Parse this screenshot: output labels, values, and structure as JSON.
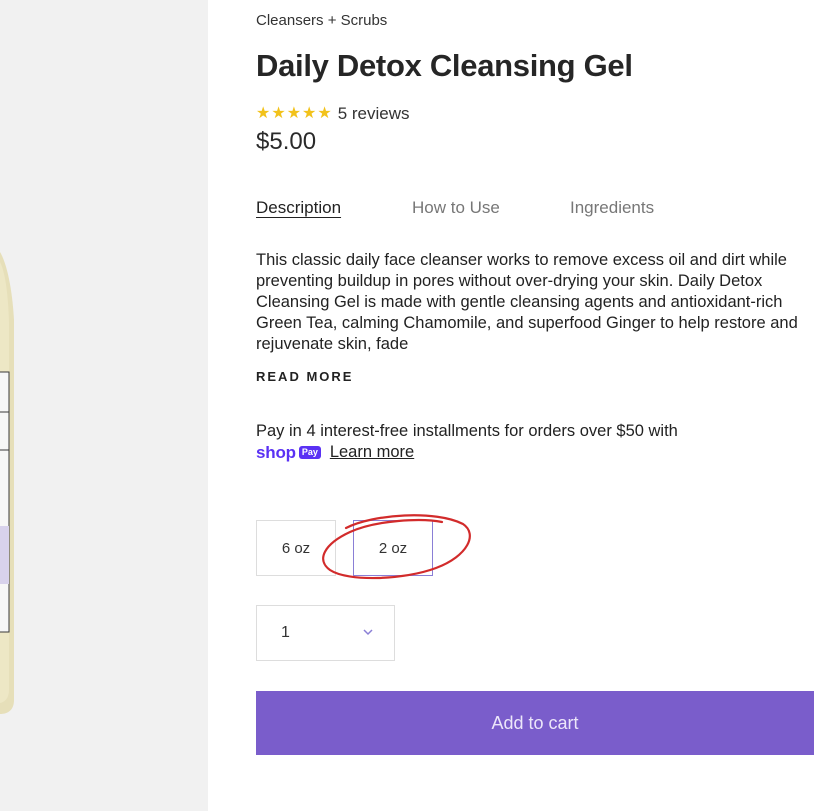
{
  "breadcrumb": "Cleansers + Scrubs",
  "product": {
    "title": "Daily Detox Cleansing Gel",
    "rating": 5,
    "review_count": "5 reviews",
    "price": "$5.00"
  },
  "tabs": [
    {
      "label": "Description",
      "active": true
    },
    {
      "label": "How to Use",
      "active": false
    },
    {
      "label": "Ingredients",
      "active": false
    }
  ],
  "description": "This classic daily face cleanser works to remove excess oil and dirt while preventing buildup in pores without over-drying your skin. Daily Detox Cleansing Gel is made with gentle cleansing agents and antioxidant-rich Green Tea, calming Chamomile, and superfood Ginger to help restore and rejuvenate skin, fade",
  "read_more": "READ MORE",
  "installments": {
    "text": "Pay in 4 interest-free installments for orders over $50 with",
    "shop_logo": "shop",
    "pay_badge": "Pay",
    "learn_more": "Learn more"
  },
  "variants": [
    {
      "label": "6 oz",
      "selected": false
    },
    {
      "label": "2 oz",
      "selected": true
    }
  ],
  "quantity": {
    "value": "1",
    "icon": "chevron-down-icon"
  },
  "add_to_cart": "Add to cart",
  "colors": {
    "accent": "#7a5dcb",
    "star": "#f2c21a",
    "shop_pay": "#5a31f4",
    "annotation": "#d22b2b"
  }
}
